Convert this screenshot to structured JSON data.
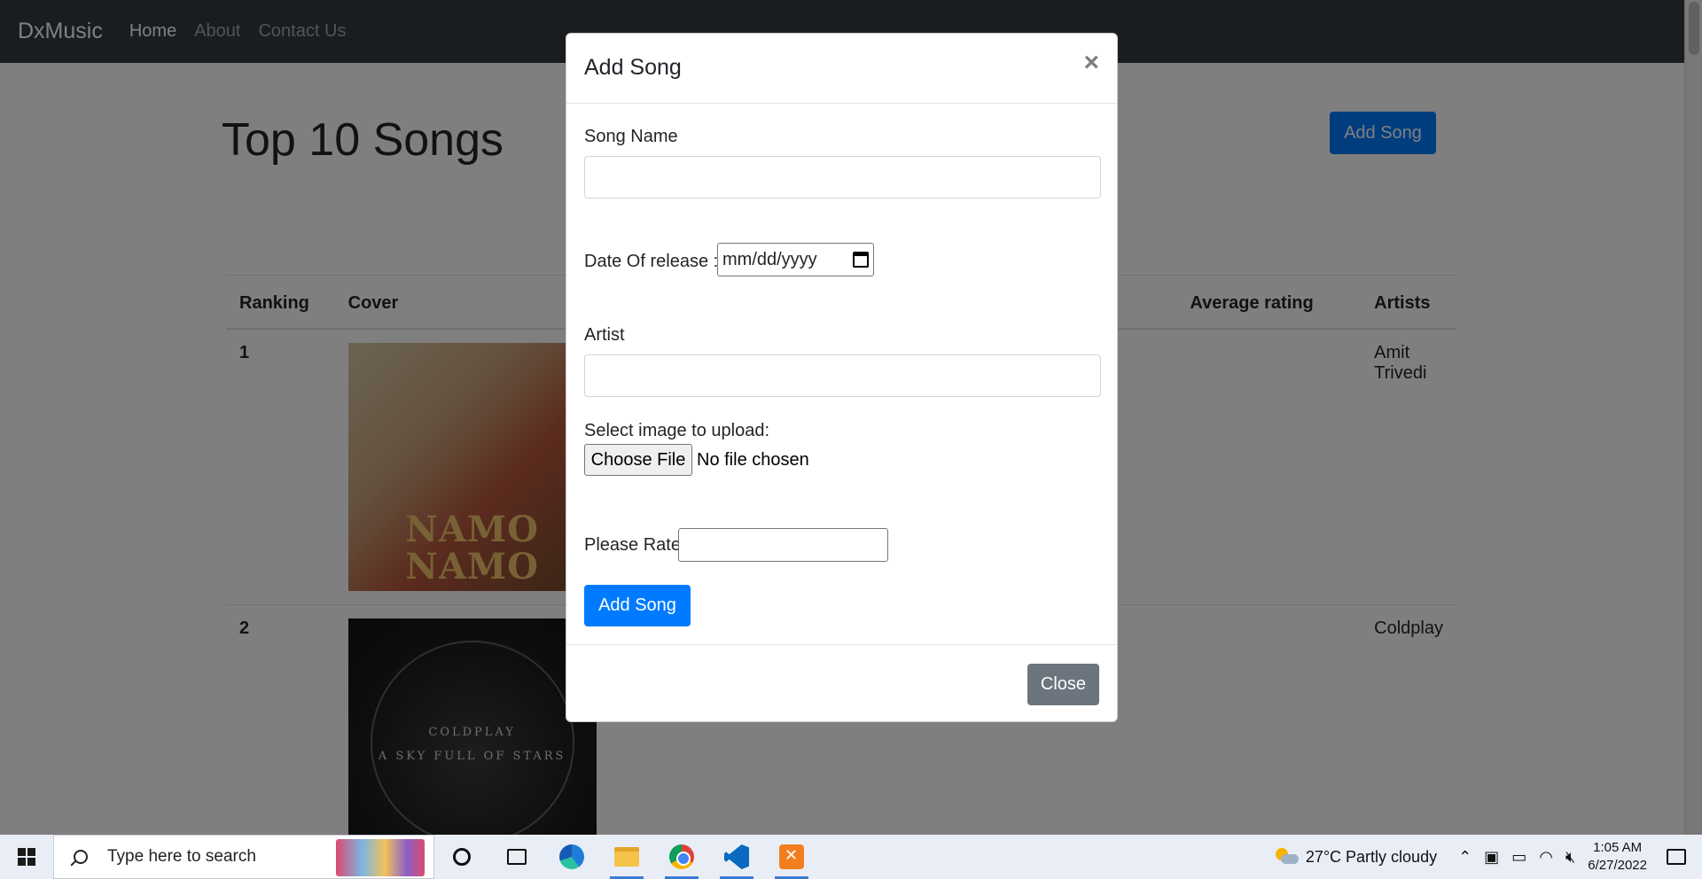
{
  "navbar": {
    "brand": "DxMusic",
    "links": [
      "Home",
      "About",
      "Contact Us"
    ]
  },
  "page": {
    "heading": "Top 10 Songs",
    "add_button": "Add Song"
  },
  "table": {
    "headers": [
      "Ranking",
      "Cover",
      "",
      "",
      "Average rating",
      "Artists"
    ],
    "rows": [
      {
        "rank": "1",
        "cover_title": "NAMO NAMO",
        "artist": "Amit Trivedi"
      },
      {
        "rank": "2",
        "cover_band": "COLDPLAY",
        "cover_title": "A SKY FULL OF STARS",
        "artist": "Coldplay"
      }
    ]
  },
  "modal": {
    "title": "Add Song",
    "close_symbol": "×",
    "song_name_label": "Song Name",
    "song_name_value": "",
    "date_label": "Date Of release :",
    "date_placeholder": "mm/dd/yyyy",
    "artist_label": "Artist",
    "artist_value": "",
    "image_label": "Select image to upload:",
    "file_button": "Choose File",
    "file_status": "No file chosen",
    "rate_label": "Please Rate",
    "rate_value": "",
    "submit_button": "Add Song",
    "close_button": "Close"
  },
  "taskbar": {
    "search_placeholder": "Type here to search",
    "weather": "27°C  Partly cloudy",
    "time": "1:05 AM",
    "date": "6/27/2022",
    "apps": [
      "cortana-icon",
      "task-view-icon",
      "edge-icon",
      "file-explorer-icon",
      "chrome-icon",
      "vscode-icon",
      "xampp-icon"
    ]
  },
  "colors": {
    "navbar_bg": "#343a40",
    "primary": "#007bff",
    "secondary": "#6c757d",
    "backdrop": "rgba(0,0,0,0.5)"
  }
}
